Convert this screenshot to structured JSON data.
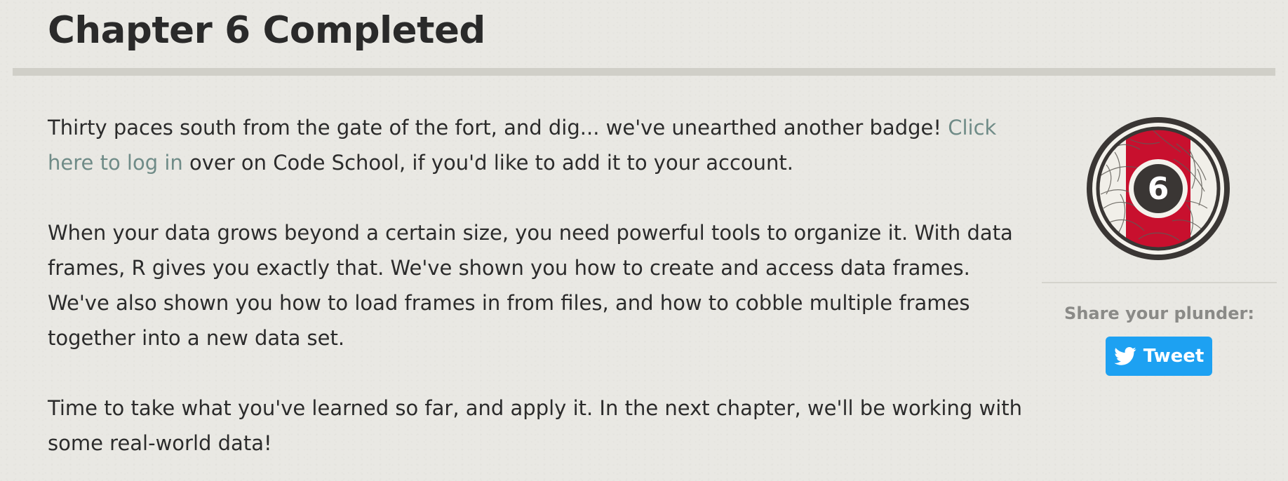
{
  "header": {
    "title": "Chapter 6 Completed"
  },
  "content": {
    "paragraph_1_before_link": "Thirty paces south from the gate of the fort, and dig... we've unearthed another badge! ",
    "login_link_text": "Click here to log in",
    "paragraph_1_after_link": " over on Code School, if you'd like to add it to your account.",
    "paragraph_2": "When your data grows beyond a certain size, you need powerful tools to organize it. With data frames, R gives you exactly that. We've shown you how to create and access data frames. We've also shown you how to load frames in from files, and how to cobble multiple frames together into a new data set.",
    "paragraph_3": "Time to take what you've learned so far, and apply it. In the next chapter, we'll be working with some real-world data!"
  },
  "badge": {
    "number": "6",
    "icon": "chapter-badge-icon",
    "colors": {
      "ring": "#3a3634",
      "stripe": "#c8102e",
      "engraving": "#f1efe9"
    }
  },
  "sidebar": {
    "share_label": "Share your plunder:",
    "tweet_label": "Tweet",
    "tweet_icon": "twitter-bird-icon"
  },
  "colors": {
    "background": "#ecebe6",
    "text": "#2b2b2b",
    "link": "#6f8b87",
    "tweet_button": "#1da1f2",
    "rule": "#d0cfc8"
  }
}
